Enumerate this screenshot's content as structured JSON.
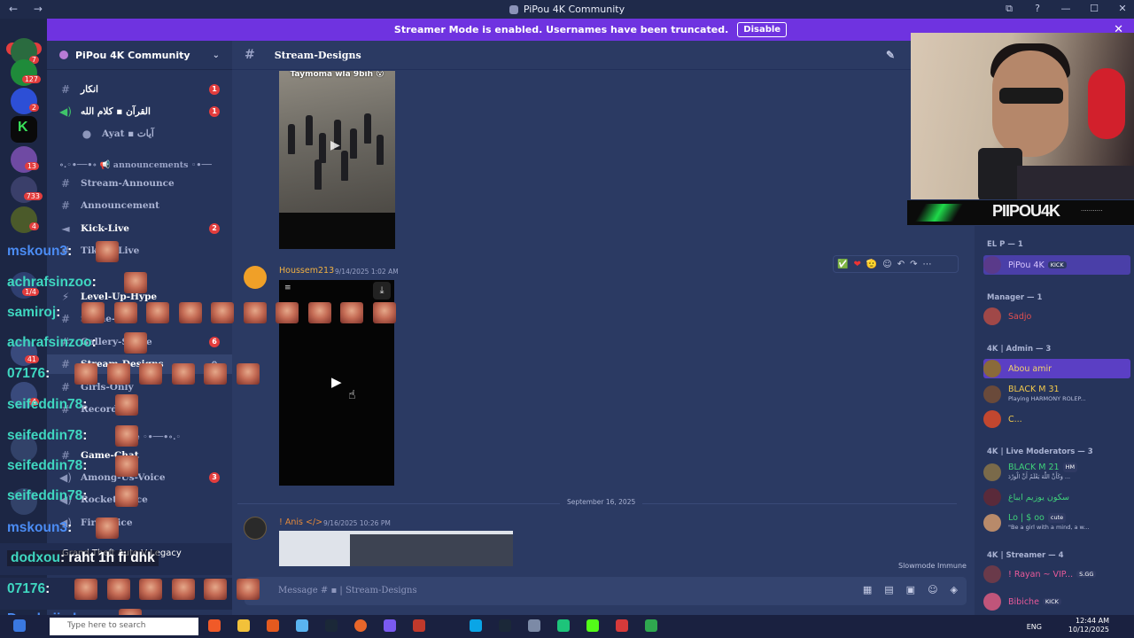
{
  "window": {
    "title": "PiPou 4K Community",
    "nav_back": "←",
    "nav_fwd": "→",
    "controls": [
      "⧉",
      "?",
      "—",
      "☐",
      "✕"
    ]
  },
  "banner": {
    "text": "Streamer Mode is enabled. Usernames have been truncated.",
    "button": "Disable",
    "close": "✕"
  },
  "rail": {
    "new_label": "NEW",
    "badges": [
      "7",
      "127",
      "2",
      "13",
      "733",
      "4",
      "1/4",
      "41",
      "4"
    ]
  },
  "server": {
    "name": "PiPou 4K Community",
    "chevron": "⌄"
  },
  "channels": [
    {
      "label": "انكار",
      "unread": "1"
    },
    {
      "label": "القرآن ▪ كلام الله",
      "unread": "1"
    },
    {
      "label": "Ayat ▪ آيات"
    },
    {
      "label": "Stream-Announce"
    },
    {
      "label": "Announcement"
    },
    {
      "label": "Kick-Live",
      "unread": "2"
    },
    {
      "label": "Tiktok-Live"
    },
    {
      "label": "Level-Up-Hype"
    },
    {
      "label": "Scene-Ch"
    },
    {
      "label": "Gallery-Share",
      "unread": "6"
    },
    {
      "label": "Stream-Designs"
    },
    {
      "label": "Girls-Only"
    },
    {
      "label": "Records"
    },
    {
      "label": "Game-Chat"
    },
    {
      "label": "Among-Us-Voice",
      "unread": "3"
    },
    {
      "label": "Rocket-Voice"
    },
    {
      "label": "Fire-Voice"
    }
  ],
  "categories": [
    {
      "label": "∘.◦•──•∘ 📢 announcements ◦•──"
    },
    {
      "label": "zone ◦•──•∘.◦"
    }
  ],
  "game_status": {
    "title": "Grand Theft Auto V Legacy"
  },
  "chat": {
    "channel": "Stream-Designs",
    "video1_caption": "Taymoma wla 9bih 😮",
    "messages": [
      {
        "author": "Houssem213",
        "time": "9/14/2025 1:02 AM"
      },
      {
        "author": "! Anis </>",
        "time": "9/16/2025 10:26 PM"
      }
    ],
    "date_separator": "September 16, 2025",
    "slowmode": "Slowmode Immune",
    "composer_placeholder": "Message # ▪ | Stream-Designs",
    "toolbar": [
      "✅",
      "❤",
      "🫡",
      "☺",
      "↶",
      "↷",
      "⋯"
    ]
  },
  "members": {
    "groups": [
      {
        "header": "EL P — 1",
        "items": [
          {
            "name": "PiPou 4K",
            "tag": "KICK"
          }
        ]
      },
      {
        "header": "Manager — 1",
        "items": [
          {
            "name": "Sadjo"
          }
        ]
      },
      {
        "header": "4K | Admin — 3",
        "items": [
          {
            "name": "Abou amir"
          },
          {
            "name": "BLACK M 31",
            "sub": "Playing HARMONY ROLEP..."
          },
          {
            "name": "C..."
          }
        ]
      },
      {
        "header": "4K | Live Moderators — 3",
        "items": [
          {
            "name": "BLACK M 21",
            "tag": "HM",
            "sub": "وَكَأَنَّ اللَّهَ يَعْلَمُ أَنَّ الْوَرْدَ ..."
          },
          {
            "name": "سكون يوزيم ايباغ"
          },
          {
            "name": "Lo | $ oo",
            "tag": "cute",
            "sub": "\"Be a girl with a mind, a w..."
          }
        ]
      },
      {
        "header": "4K | Streamer — 4",
        "items": [
          {
            "name": "! Rayan ~ VIP...",
            "tag": "S.GG"
          },
          {
            "name": "Bibiche",
            "tag": "KICK"
          }
        ]
      }
    ]
  },
  "overlay": {
    "streamer_name": "PIIPOU4K",
    "dots": "···········",
    "chat_lines": [
      {
        "user": "mskoun3",
        "color": "blue",
        "text": ":"
      },
      {
        "user": "achrafsinzoo",
        "color": "teal",
        "text": ":"
      },
      {
        "user": "samiroj",
        "color": "teal",
        "text": ":"
      },
      {
        "user": "achrafsinzoo",
        "color": "teal",
        "text": ":"
      },
      {
        "user": "07176",
        "color": "teal",
        "text": ":"
      },
      {
        "user": "seifeddin78",
        "color": "teal",
        "text": ":"
      },
      {
        "user": "seifeddin78",
        "color": "teal",
        "text": ":"
      },
      {
        "user": "seifeddin78",
        "color": "teal",
        "text": ":"
      },
      {
        "user": "seifeddin78",
        "color": "teal",
        "text": ":"
      },
      {
        "user": "mskoun3",
        "color": "blue",
        "text": ":"
      },
      {
        "user": "dodxou",
        "color": "teal",
        "text": ": raht 1h fi dhk"
      },
      {
        "user": "07176",
        "color": "teal",
        "text": ":"
      },
      {
        "user": "Damhaji_dz",
        "color": "blue",
        "text": ":"
      }
    ]
  },
  "taskbar": {
    "search_placeholder": "Type here to search",
    "lang": "ENG",
    "time": "12:44 AM",
    "date": "10/12/2025"
  }
}
